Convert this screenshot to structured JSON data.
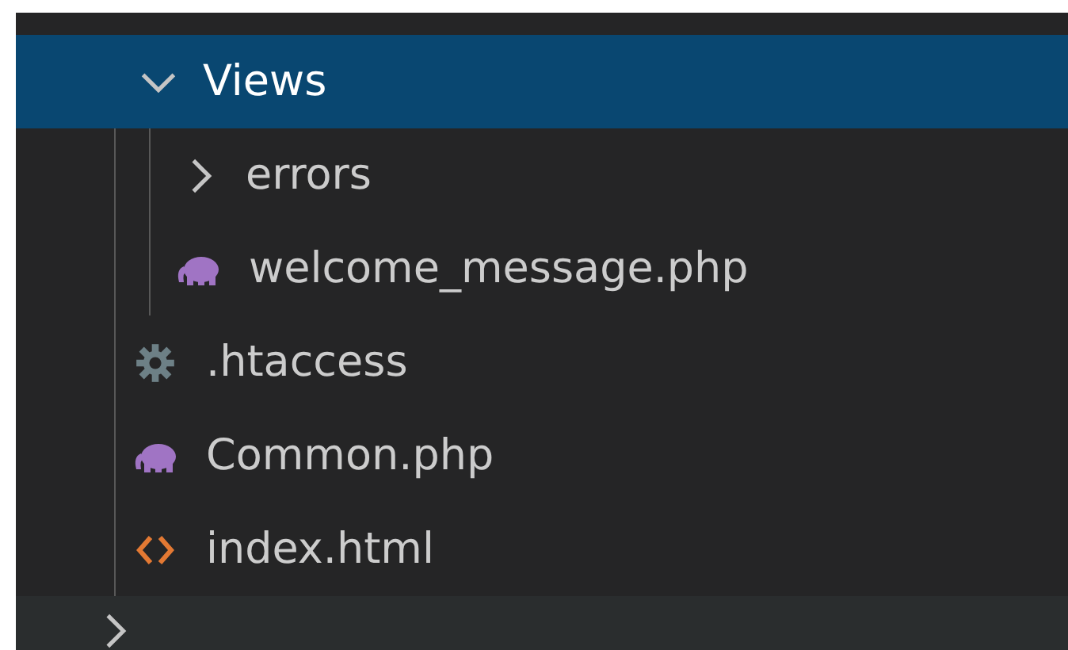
{
  "explorer": {
    "items": [
      {
        "label": "Views",
        "kind": "folder",
        "expanded": true,
        "selected": true,
        "children": [
          {
            "label": "errors",
            "kind": "folder",
            "expanded": false,
            "selected": false
          },
          {
            "label": "welcome_message.php",
            "kind": "php",
            "selected": false
          }
        ]
      },
      {
        "label": ".htaccess",
        "kind": "config",
        "selected": false
      },
      {
        "label": "Common.php",
        "kind": "php",
        "selected": false
      },
      {
        "label": "index.html",
        "kind": "html",
        "selected": false
      }
    ],
    "next_folder": {
      "kind": "folder",
      "expanded": false,
      "selected": false
    }
  }
}
